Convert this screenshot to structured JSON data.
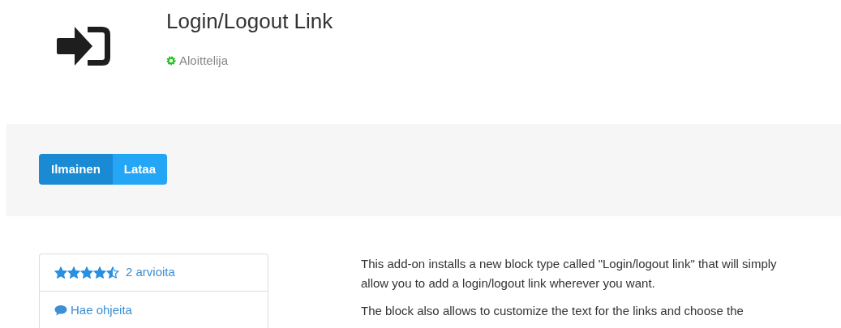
{
  "title": "Login/Logout Link",
  "level": "Aloittelija",
  "price_button": "Ilmainen",
  "download_button": "Lataa",
  "rating": {
    "stars": 4.5,
    "count": "2 arvioita"
  },
  "support_link": "Hae ohjeita",
  "description": [
    "This add-on installs a new block type called \"Login/logout link\" that will simply allow you to add a login/logout link wherever you want.",
    "The block also allows to customize the text for the links and choose the"
  ]
}
